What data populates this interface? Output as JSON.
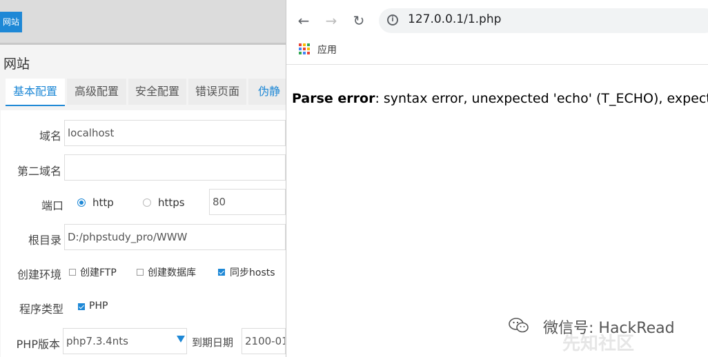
{
  "left_panel": {
    "site_button": "网站",
    "dialog_title": "网站",
    "tabs": [
      {
        "label": "基本配置",
        "active": true
      },
      {
        "label": "高级配置",
        "active": false
      },
      {
        "label": "安全配置",
        "active": false
      },
      {
        "label": "错误页面",
        "active": false
      },
      {
        "label": "伪静",
        "active": false
      }
    ],
    "form": {
      "domain_label": "域名",
      "domain_value": "localhost",
      "second_domain_label": "第二域名",
      "second_domain_value": "",
      "port_label": "端口",
      "http_label": "http",
      "https_label": "https",
      "port_value": "80",
      "protocol_selected": "http",
      "root_label": "根目录",
      "root_value": "D:/phpstudy_pro/WWW",
      "env_label": "创建环境",
      "env_options": [
        {
          "label": "创建FTP",
          "checked": false
        },
        {
          "label": "创建数据库",
          "checked": false
        },
        {
          "label": "同步hosts",
          "checked": true
        }
      ],
      "program_type_label": "程序类型",
      "program_type_option": {
        "label": "PHP",
        "checked": true
      },
      "php_version_label": "PHP版本",
      "php_version_value": "php7.3.4nts",
      "expire_label": "到期日期",
      "expire_value": "2100-01"
    }
  },
  "browser": {
    "url": "127.0.0.1/1.php",
    "bookmark_apps_label": "应用",
    "error_bold": "Parse error",
    "error_text": ": syntax error, unexpected 'echo' (T_ECHO), expectin",
    "watermark": "微信号: HackRead",
    "watermark2": "先知社区",
    "accent_color": "#1e88d6"
  }
}
